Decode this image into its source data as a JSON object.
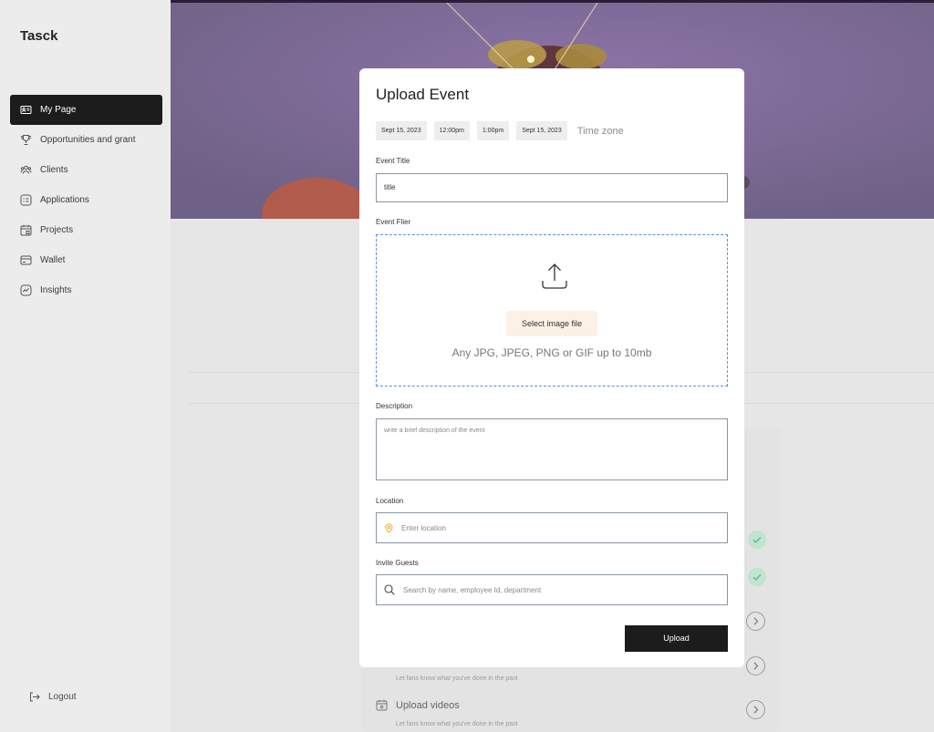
{
  "app": {
    "brand": "Tasck"
  },
  "sidebar": {
    "items": [
      {
        "label": "My Page",
        "icon": "id-card-icon",
        "active": true
      },
      {
        "label": "Opportunities and grant",
        "icon": "trophy-icon",
        "active": false
      },
      {
        "label": "Clients",
        "icon": "users-icon",
        "active": false
      },
      {
        "label": "Applications",
        "icon": "application-icon",
        "active": false
      },
      {
        "label": "Projects",
        "icon": "calendar-icon",
        "active": false
      },
      {
        "label": "Wallet",
        "icon": "wallet-icon",
        "active": false
      },
      {
        "label": "Insights",
        "icon": "insights-icon",
        "active": false
      }
    ],
    "logout_label": "Logout"
  },
  "background": {
    "row_sub_1": "Let fans know what you've done in the past",
    "row_title_2": "Upload videos",
    "row_sub_2": "Let fans know what you've done in the past"
  },
  "modal": {
    "title": "Upload Event",
    "chips": [
      "Sept 15, 2023",
      "12:00pm",
      "1:00pm",
      "Sept 15, 2023"
    ],
    "timezone_label": "Time zone",
    "event_title_label": "Event Title",
    "event_title_value": "title",
    "event_flier_label": "Event Flier",
    "select_file_label": "Select image file",
    "file_hint": "Any JPG, JPEG, PNG or GIF up to 10mb",
    "description_label": "Description",
    "description_placeholder": "write a brief description of the event",
    "location_label": "Location",
    "location_placeholder": "Enter location",
    "guests_label": "Invite Guests",
    "guests_placeholder": "Search by name, employee Id, department",
    "upload_label": "Upload"
  },
  "colors": {
    "primary_dark": "#1c1c1c",
    "dropzone_border": "#5b8fd6",
    "select_button_bg": "#fbf1e4",
    "location_pin": "#f0a53a",
    "check_bg": "#bfe4cf"
  }
}
